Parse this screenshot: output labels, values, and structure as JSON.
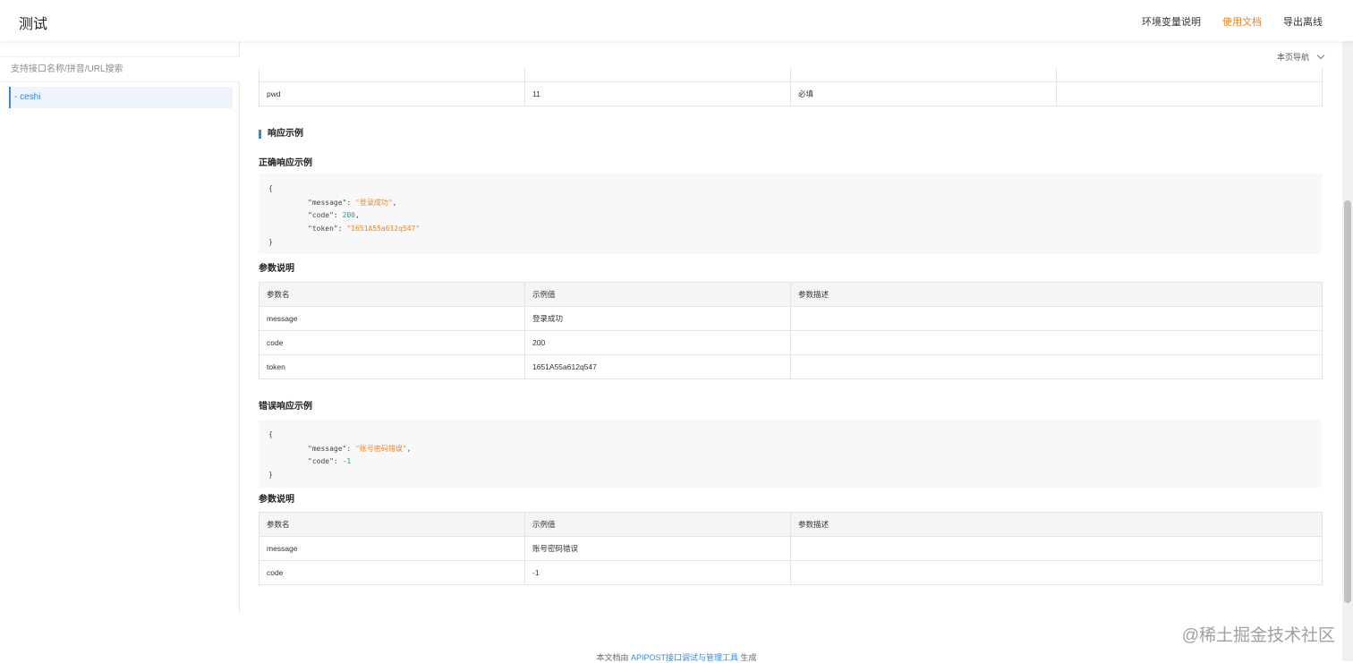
{
  "header": {
    "title": "测试",
    "nav": [
      {
        "label": "环境变量说明",
        "active": false
      },
      {
        "label": "使用文档",
        "active": true
      },
      {
        "label": "导出离线",
        "active": false
      }
    ]
  },
  "sidebar": {
    "search_placeholder": "支持接口名称/拼音/URL搜索",
    "items": [
      {
        "label": "- ceshi"
      }
    ]
  },
  "page_nav": {
    "label": "本页导航"
  },
  "request_table": {
    "partial_row": [
      "",
      "",
      "",
      ""
    ],
    "rows": [
      [
        "pwd",
        "11",
        "必填",
        ""
      ]
    ]
  },
  "response_section": {
    "title": "响应示例"
  },
  "success": {
    "title": "正确响应示例",
    "code": {
      "open": "{",
      "lines": [
        {
          "key": "\"message\"",
          "value": "\"登录成功\"",
          "type": "string",
          "comma": ","
        },
        {
          "key": "\"code\"",
          "value": "200",
          "type": "number",
          "comma": ","
        },
        {
          "key": "\"token\"",
          "value": "\"1651A55a612q547\"",
          "type": "string",
          "comma": ""
        }
      ],
      "close": "}"
    },
    "params_title": "参数说明",
    "headers": [
      "参数名",
      "示例值",
      "参数描述"
    ],
    "rows": [
      [
        "message",
        "登录成功",
        ""
      ],
      [
        "code",
        "200",
        ""
      ],
      [
        "token",
        "1651A55a612q547",
        ""
      ]
    ]
  },
  "error": {
    "title": "错误响应示例",
    "code": {
      "open": "{",
      "lines": [
        {
          "key": "\"message\"",
          "value": "\"账号密码错误\"",
          "type": "string",
          "comma": ","
        },
        {
          "key": "\"code\"",
          "value": "-1",
          "type": "number",
          "comma": ""
        }
      ],
      "close": "}"
    },
    "params_title": "参数说明",
    "headers": [
      "参数名",
      "示例值",
      "参数描述"
    ],
    "rows": [
      [
        "message",
        "账号密码错误",
        ""
      ],
      [
        "code",
        "-1",
        ""
      ]
    ]
  },
  "footer": {
    "prefix": "本文档由",
    "link": "APIPOST接口调试与管理工具",
    "suffix": "生成"
  },
  "watermark": "@稀土掘金技术社区",
  "colors": {
    "accent": "#e6852b",
    "link": "#3a88d8",
    "number": "#2b9a8a"
  }
}
